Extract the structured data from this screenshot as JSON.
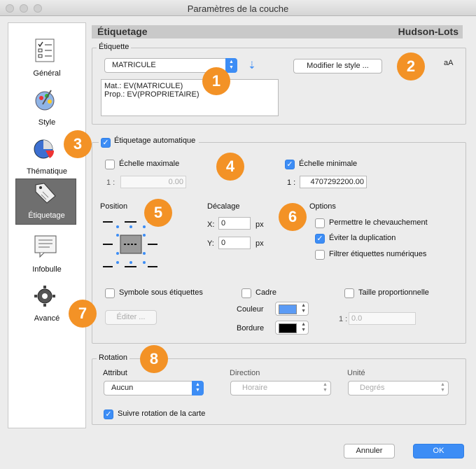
{
  "window": {
    "title": "Paramètres de la couche"
  },
  "sidebar": {
    "items": [
      {
        "label": "Général",
        "icon": "checklist-icon"
      },
      {
        "label": "Style",
        "icon": "palette-icon"
      },
      {
        "label": "Thématique",
        "icon": "pie-chart-icon"
      },
      {
        "label": "Étiquetage",
        "icon": "tag-icon"
      },
      {
        "label": "Infobulle",
        "icon": "tooltip-icon"
      },
      {
        "label": "Avancé",
        "icon": "gear-icon"
      }
    ],
    "selected": "Étiquetage"
  },
  "header": {
    "title": "Étiquetage",
    "layer": "Hudson-Lots"
  },
  "etiquette": {
    "legend": "Étiquette",
    "field_value": "MATRICULE",
    "modify_style_label": "Modifier le style ...",
    "style_preview": "aA",
    "expression_lines": [
      "Mat.: EV(MATRICULE)",
      "Prop.: EV(PROPRIETAIRE)"
    ]
  },
  "auto": {
    "label": "Étiquetage automatique",
    "checked": true,
    "max_scale": {
      "label": "Échelle maximale",
      "checked": false,
      "prefix": "1 :",
      "value": "0.00"
    },
    "min_scale": {
      "label": "Échelle minimale",
      "checked": true,
      "prefix": "1 :",
      "value": "4707292200.00"
    },
    "position_label": "Position",
    "offset": {
      "label": "Décalage",
      "x_label": "X:",
      "x_value": "0",
      "y_label": "Y:",
      "y_value": "0",
      "unit": "px"
    },
    "options": {
      "label": "Options",
      "items": [
        {
          "label": "Permettre le chevauchement",
          "checked": false
        },
        {
          "label": "Éviter la duplication",
          "checked": true
        },
        {
          "label": "Filtrer étiquettes numériques",
          "checked": false
        }
      ]
    },
    "symbol_under": {
      "label": "Symbole sous étiquettes",
      "checked": false
    },
    "edit_label": "Éditer ...",
    "frame": {
      "label": "Cadre",
      "checked": false,
      "color_label": "Couleur",
      "color": "#5b9bf5",
      "border_label": "Bordure",
      "border_color": "#000000"
    },
    "proportional": {
      "label": "Taille proportionnelle",
      "checked": false,
      "prefix": "1 :",
      "value": "0.0"
    }
  },
  "rotation": {
    "legend": "Rotation",
    "attribute_label": "Attribut",
    "attribute_value": "Aucun",
    "direction_label": "Direction",
    "direction_value": "Horaire",
    "unit_label": "Unité",
    "unit_value": "Degrés",
    "follow_map": {
      "label": "Suivre rotation de la carte",
      "checked": true
    }
  },
  "footer": {
    "cancel_label": "Annuler",
    "ok_label": "OK"
  },
  "badges": [
    "1",
    "2",
    "3",
    "4",
    "5",
    "6",
    "7",
    "8"
  ],
  "colors": {
    "accent": "#3d8df5",
    "badge": "#f39226",
    "selection": "#6f6f6f"
  }
}
